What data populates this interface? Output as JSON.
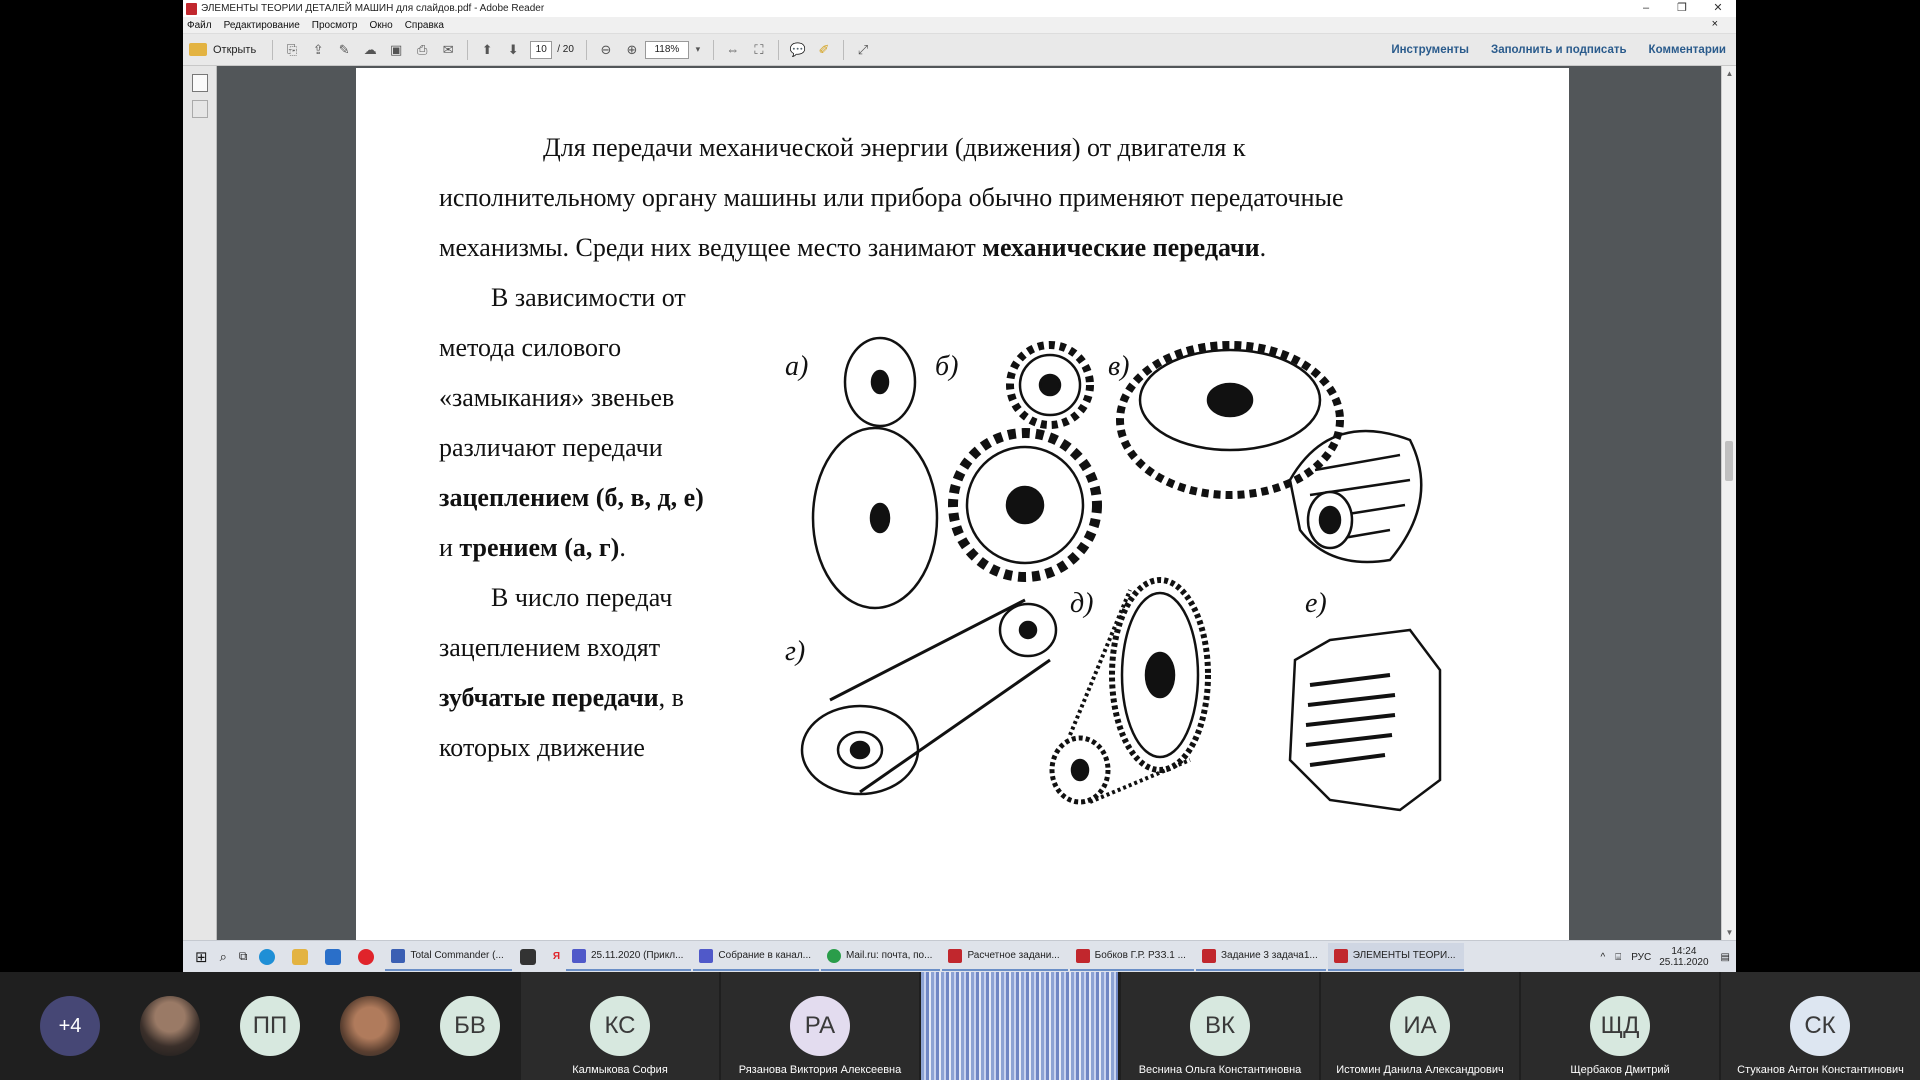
{
  "window": {
    "title": "ЭЛЕМЕНТЫ ТЕОРИИ ДЕТАЛЕЙ МАШИН для слайдов.pdf - Adobe Reader",
    "controls": {
      "minimize": "–",
      "restore": "❐",
      "close": "✕"
    }
  },
  "menu": [
    "Файл",
    "Редактирование",
    "Просмотр",
    "Окно",
    "Справка"
  ],
  "menu_close": "×",
  "toolbar": {
    "open_label": "Открыть",
    "page_current": "10",
    "page_total": "/ 20",
    "zoom": "118%",
    "tools_label": "Инструменты",
    "fill_sign_label": "Заполнить и подписать",
    "comments_label": "Комментарии"
  },
  "document": {
    "p1_line1": "Для передачи механической энергии (движения) от двигателя к",
    "p1_line2": "исполнительному органу машины или прибора обычно применяют передаточные",
    "p1_line3_a": "механизмы. Среди них ведущее место занимают ",
    "p1_line3_b": "механические передачи",
    "p1_line3_c": ".",
    "p2_l1": "В зависимости от",
    "p2_l2": "метода силового",
    "p2_l3": "«замыкания» звеньев",
    "p2_l4": "различают передачи",
    "p2_l5": "зацеплением (б, в, д, е)",
    "p2_l6_a": "и ",
    "p2_l6_b": "трением (а, г)",
    "p2_l6_c": ".",
    "p3_l1": "В число передач",
    "p3_l2": "зацеплением входят",
    "p3_l3_a": "зубчатые передачи",
    "p3_l3_b": ", в",
    "p3_l4": "которых движение",
    "fig_labels": {
      "a": "а)",
      "b": "б)",
      "v": "в)",
      "g": "г)",
      "d": "д)",
      "e": "е)"
    }
  },
  "taskbar": {
    "apps": [
      {
        "label": "Total Commander (...",
        "color": "#3b5fb3"
      },
      {
        "label": "25.11.2020 (Прикл...",
        "color": "#5059c9"
      },
      {
        "label": "Собрание в канал...",
        "color": "#5059c9"
      },
      {
        "label": "Mail.ru: почта, по...",
        "color": "#2a9d4a"
      },
      {
        "label": "Расчетное задани...",
        "color": "#c1272d"
      },
      {
        "label": "Бобков Г.Р. РЗЗ.1 ...",
        "color": "#c1272d"
      },
      {
        "label": "Задание 3 задача1...",
        "color": "#c1272d"
      },
      {
        "label": "ЭЛЕМЕНТЫ ТЕОРИ...",
        "color": "#c1272d"
      }
    ],
    "lang": "РУС",
    "time": "14:24",
    "date": "25.11.2020"
  },
  "participants": {
    "more": "+4",
    "small": [
      {
        "initials": "ПП"
      },
      {
        "initials": "БВ"
      }
    ],
    "tiles": [
      {
        "initials": "КС",
        "name": "Калмыкова София"
      },
      {
        "initials": "РА",
        "name": "Рязанова Виктория Алексеевна"
      },
      {
        "initials": "ВК",
        "name": "Веснина Ольга Константиновна"
      },
      {
        "initials": "ИА",
        "name": "Истомин Данила Александрович"
      },
      {
        "initials": "ЩД",
        "name": "Щербаков Дмитрий"
      },
      {
        "initials": "СК",
        "name": "Стуканов Антон Константинович"
      }
    ]
  },
  "colors": {
    "link_blue": "#2a5b8c",
    "avatar_green": "#d7e8df",
    "avatar_purple": "#4a4a8c"
  }
}
